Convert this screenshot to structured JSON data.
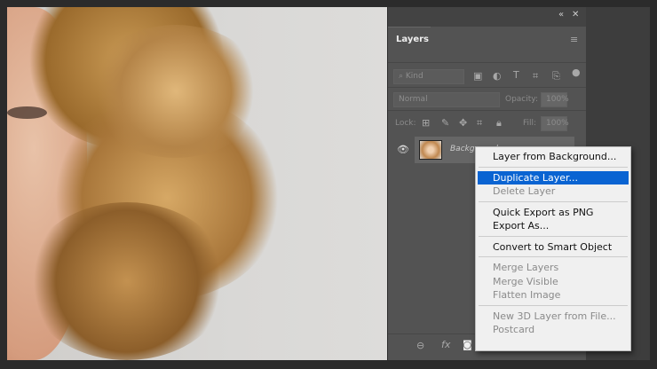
{
  "panel": {
    "tab": "Layers",
    "kind_placeholder": "Kind",
    "blend_mode": "Normal",
    "opacity_label": "Opacity:",
    "opacity_value": "100%",
    "lock_label": "Lock:",
    "fill_label": "Fill:",
    "fill_value": "100%",
    "layer_name": "Background",
    "collapse_icon": "«",
    "close_icon": "✕"
  },
  "menu": {
    "groups": [
      [
        "Layer from Background..."
      ],
      [
        "Duplicate Layer...",
        "Delete Layer"
      ],
      [
        "Quick Export as PNG",
        "Export As..."
      ],
      [
        "Convert to Smart Object"
      ],
      [
        "Merge Layers",
        "Merge Visible",
        "Flatten Image"
      ],
      [
        "New 3D Layer from File...",
        "Postcard"
      ]
    ],
    "selected": "Duplicate Layer...",
    "disabled": [
      "Delete Layer",
      "Merge Layers",
      "Merge Visible",
      "Flatten Image",
      "New 3D Layer from File...",
      "Postcard"
    ]
  },
  "footer": {
    "fx": "fx"
  }
}
